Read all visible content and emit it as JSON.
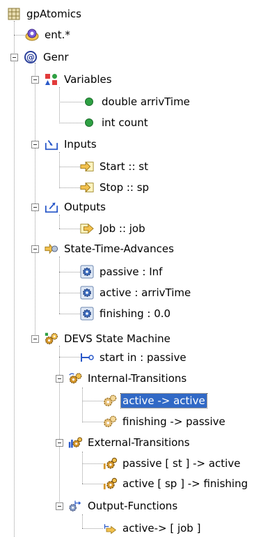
{
  "tree": {
    "root": "gpAtomics",
    "ent": "ent.*",
    "genr": "Genr",
    "variables": {
      "label": "Variables",
      "items": [
        "double arrivTime",
        "int count"
      ]
    },
    "inputs": {
      "label": "Inputs",
      "items": [
        "Start :: st",
        "Stop :: sp"
      ]
    },
    "outputs": {
      "label": "Outputs",
      "items": [
        "Job :: job"
      ]
    },
    "sta": {
      "label": "State-Time-Advances",
      "items": [
        "passive : Inf",
        "active : arrivTime",
        "finishing : 0.0"
      ]
    },
    "devs": {
      "label": "DEVS State Machine",
      "start": "start in : passive",
      "internal": {
        "label": "Internal-Transitions",
        "items": [
          "active -> active",
          "finishing -> passive"
        ]
      },
      "external": {
        "label": "External-Transitions",
        "items": [
          "passive [ st ] -> active",
          "active [ sp ] -> finishing"
        ]
      },
      "output": {
        "label": "Output-Functions",
        "items": [
          "active-> [ job ]"
        ]
      }
    }
  },
  "colors": {
    "selection": "#3169c6",
    "variable_dot": "#2ea043",
    "gear": "#d4962a"
  }
}
